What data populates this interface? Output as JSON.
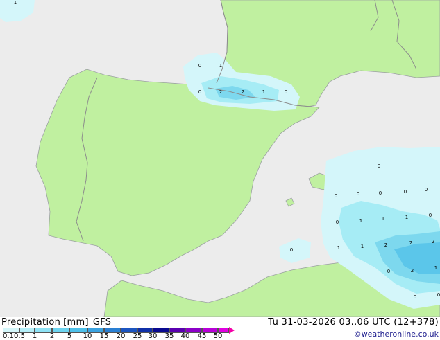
{
  "map": {
    "colors": {
      "sea": "#ececec",
      "land": "#c0f0a0",
      "border": "#8c8c8c",
      "coast": "#9aa0a0",
      "precip_0_1": "#d4f6fa",
      "precip_0_5": "#a6ecf5",
      "precip_1": "#7dd8ee",
      "precip_2": "#5bc6ea"
    },
    "value_labels": [
      "1",
      "0",
      "1",
      "0",
      "2",
      "2",
      "1",
      "0",
      "0",
      "0",
      "0",
      "0",
      "0",
      "0",
      "1",
      "1",
      "0",
      "1",
      "0",
      "1",
      "1",
      "2",
      "2",
      "2",
      "1",
      "0",
      "2",
      "0",
      "0",
      "0"
    ]
  },
  "legend": {
    "title": "Precipitation",
    "unit": "[mm]",
    "model": "GFS",
    "date": "Tu 31-03-2026 03..06 UTC (12+378)",
    "credit": "©weatheronline.co.uk",
    "scale_ticks": [
      "0.1",
      "0.5",
      "1",
      "2",
      "5",
      "10",
      "15",
      "20",
      "25",
      "30",
      "35",
      "40",
      "45",
      "50"
    ],
    "scale_colors": [
      "#d4f6fa",
      "#b4eef8",
      "#8ee2f5",
      "#6cd4f0",
      "#4ec0ea",
      "#3aa2e0",
      "#2a7fd2",
      "#1c55c0",
      "#1030a8",
      "#0a0a90",
      "#5a00b0",
      "#8c00c8",
      "#b800d8",
      "#e000e0",
      "#f400a8"
    ]
  }
}
